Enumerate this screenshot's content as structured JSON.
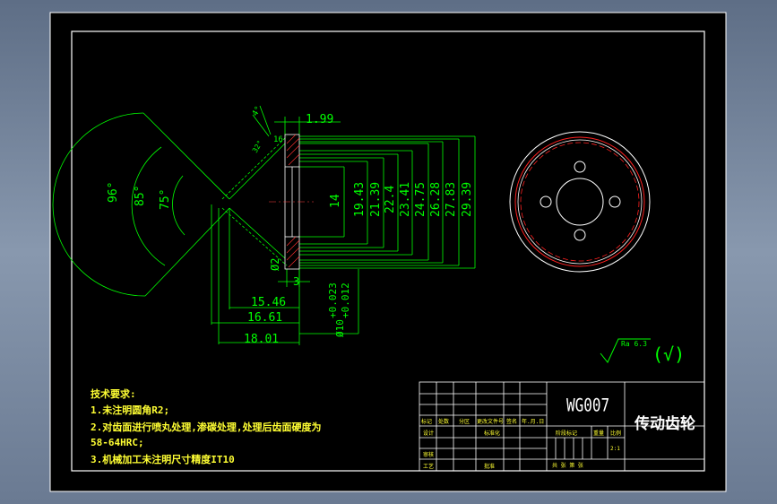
{
  "colors": {
    "background": "#000000",
    "frame": "#ffffff",
    "dimension": "#00ff00",
    "notes": "#ffff33",
    "title_block": "#ffffff",
    "hatch": "#ff3030",
    "outline_red": "#ff2020",
    "center_line": "#ff4040"
  },
  "dimensions": {
    "top_offset": "1.99",
    "face_width_16": "16",
    "angle_small_a": "32°",
    "angle_small_b": "4°",
    "angle_96": "96°",
    "angle_85": "85°",
    "angle_75": "75°",
    "dia_14": "14",
    "dia_19_43": "19.43",
    "dia_21_39": "21.39",
    "dia_22_4": "22.4",
    "dia_23_41": "23.41",
    "dia_24_75": "24.75",
    "dia_26_28": "26.28",
    "dia_27_83": "27.83",
    "dia_29_39": "29.39",
    "chamfer_d2": "Ø2",
    "width_3": "3",
    "bore_tol_upper": "+0.023",
    "bore_tol_lower": "+0.012",
    "bore_dia": "Ø10",
    "len_15_46": "15.46",
    "len_16_61": "16.61",
    "len_18_01": "18.01"
  },
  "roughness": {
    "value": "Ra 6.3",
    "other": "(√)"
  },
  "notes": {
    "heading": "技术要求:",
    "line1": "1.未注明圆角R2;",
    "line2": "2.对齿面进行喷丸处理,渗碳处理,处理后齿面硬度为",
    "line3": "58-64HRC;",
    "line4": "3.机械加工未注明尺寸精度IT10"
  },
  "title_block": {
    "drawing_no": "WG007",
    "part_name": "传动齿轮",
    "cell_mark": "标记",
    "cell_count": "处数",
    "cell_zone": "分区",
    "cell_doc": "更改文件号",
    "cell_sign": "签名",
    "cell_date": "年.月.日",
    "cell_design": "设计",
    "cell_standard": "标准化",
    "cell_stage": "阶段标记",
    "cell_weight": "重量",
    "cell_scale": "比例",
    "scale_value": "2:1",
    "cell_review": "审核",
    "cell_process": "工艺",
    "cell_approve": "批准",
    "cell_sheets": "共  张  第  张"
  }
}
